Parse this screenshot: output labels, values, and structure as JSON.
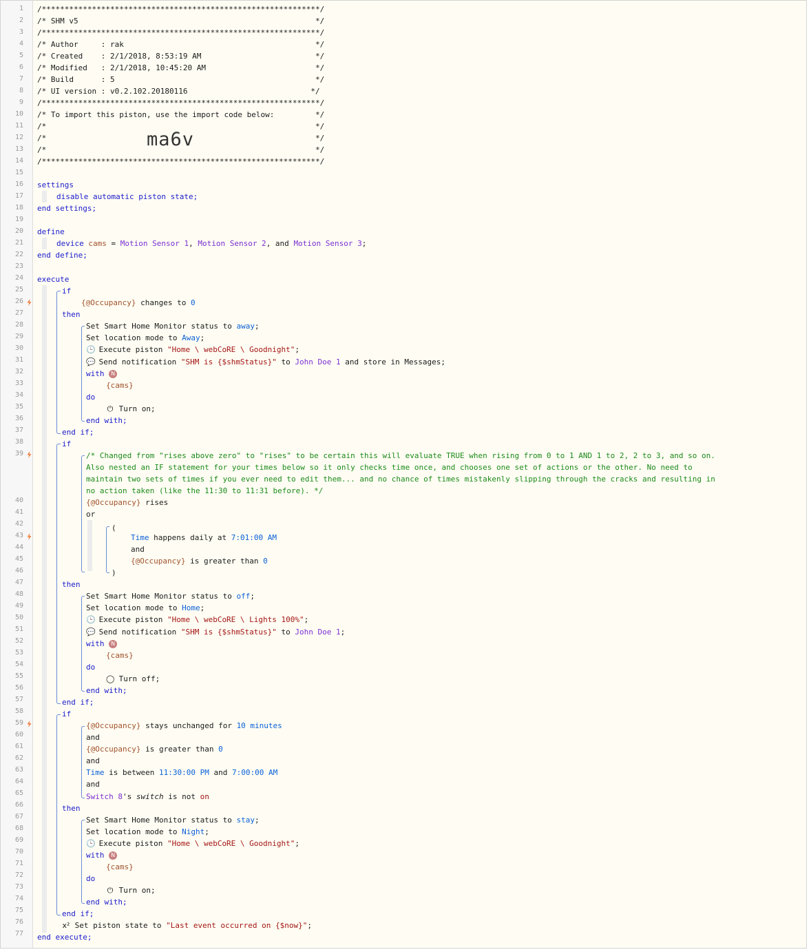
{
  "editor": {
    "line_numbers": [
      "1",
      "2",
      "3",
      "4",
      "5",
      "6",
      "7",
      "8",
      "9",
      "10",
      "11",
      "12",
      "13",
      "14",
      "15",
      "16",
      "17",
      "18",
      "19",
      "20",
      "21",
      "22",
      "23",
      "24",
      "25",
      "26",
      "27",
      "28",
      "29",
      "30",
      "31",
      "32",
      "33",
      "34",
      "35",
      "36",
      "37",
      "38",
      "39",
      "40",
      "41",
      "42",
      "43",
      "44",
      "45",
      "46",
      "47",
      "48",
      "49",
      "50",
      "51",
      "52",
      "53",
      "54",
      "55",
      "56",
      "57",
      "58",
      "59",
      "60",
      "61",
      "62",
      "63",
      "64",
      "65",
      "66",
      "67",
      "68",
      "69",
      "70",
      "71",
      "72",
      "73",
      "74",
      "75",
      "76",
      "77"
    ],
    "trigger_lines": [
      "26",
      "39",
      "43",
      "59"
    ],
    "header": {
      "border": "/*************************************************************/",
      "title": "/* SHM v5                                                    */",
      "author": "/* Author     : rak                                          */",
      "created": "/* Created    : 2/1/2018, 8:53:19 AM                         */",
      "modified": "/* Modified   : 2/1/2018, 10:45:20 AM                        */",
      "build": "/* Build      : 5                                            */",
      "ui_version": "/* UI version : v0.2.102.20180116                           */",
      "import_note": "/* To import this piston, use the import code below:         */",
      "blank_comment": "/*                                                           */",
      "import_code": "ma6v"
    },
    "settings": {
      "open": "settings",
      "body": "disable automatic piston state;",
      "close": "end settings;"
    },
    "define": {
      "open": "define",
      "device_kw": "device",
      "var_name": "cams",
      "eq": " = ",
      "dev1": "Motion Sensor 1",
      "sep1": ", ",
      "dev2": "Motion Sensor 2",
      "sep2": ", and ",
      "dev3": "Motion Sensor 3",
      "semi": ";",
      "close": "end define;"
    },
    "execute_open": "execute",
    "execute_close": "end execute;",
    "kw": {
      "if": "if",
      "then": "then",
      "end_if": "end if;",
      "with": "with",
      "do": "do",
      "end_with": "end with;",
      "and": "and",
      "or": "or",
      "open_paren": "(",
      "close_paren": ")",
      "n_badge": "N",
      "cams_ref": "{cams}",
      "occupancy": "{@Occupancy}"
    },
    "block1": {
      "cond_op": " changes to ",
      "cond_val": "0",
      "a1_pre": "Set Smart Home Monitor status to ",
      "a1_val": "away",
      "a2_pre": "Set location mode to ",
      "a2_val": "Away",
      "a3_pre": " Execute piston ",
      "a3_val": "\"Home \\ webCoRE \\ Goodnight\"",
      "a4_pre": " Send notification ",
      "a4_val": "\"SHM is {$shmStatus}\"",
      "a4_to": " to ",
      "a4_who": "John Doe 1",
      "a4_post": " and store in Messages;",
      "with_action": " Turn on;"
    },
    "block2": {
      "comment_1": "/* Changed from \"rises above zero\" to \"rises\" to be certain this will evaluate TRUE when rising from 0 to 1 AND 1 to 2, 2 to 3, and so on.",
      "comment_2": "Also nested an IF statement for your times below so it only checks time once, and chooses one set of actions or the other. No need to",
      "comment_3": "maintain two sets of times if you ever need to edit them... and no chance of times mistakenly slipping through the cracks and resulting in",
      "comment_4": "no action taken (like the 11:30 to 11:31 before). */",
      "cond1_op": " rises",
      "time_kw": "Time",
      "time_op": " happens daily at ",
      "time_val": "7:01:00 AM",
      "cond3_op": " is greater than ",
      "cond3_val": "0",
      "a1_pre": "Set Smart Home Monitor status to ",
      "a1_val": "off",
      "a2_pre": "Set location mode to ",
      "a2_val": "Home",
      "a3_pre": " Execute piston ",
      "a3_val": "\"Home \\ webCoRE \\ Lights 100%\"",
      "a4_pre": " Send notification ",
      "a4_val": "\"SHM is {$shmStatus}\"",
      "a4_to": " to ",
      "a4_who": "John Doe 1",
      "with_action": " Turn off;"
    },
    "block3": {
      "cond1_op": " stays unchanged for ",
      "cond1_val": "10 minutes",
      "cond2_op": " is greater than ",
      "cond2_val": "0",
      "time_kw": "Time",
      "time_op": " is between ",
      "time_v1": "11:30:00 PM",
      "time_and": " and ",
      "time_v2": "7:00:00 AM",
      "switch_dev": "Switch 8",
      "switch_poss": "'s ",
      "switch_attr": "switch",
      "switch_op": " is not ",
      "switch_val": "on",
      "a1_pre": "Set Smart Home Monitor status to ",
      "a1_val": "stay",
      "a2_pre": "Set location mode to ",
      "a2_val": "Night",
      "a3_pre": " Execute piston ",
      "a3_val": "\"Home \\ webCoRE \\ Goodnight\"",
      "with_action": " Turn on;"
    },
    "final": {
      "pre": " Set piston state to ",
      "val": "\"Last event occurred on {$now}\""
    }
  }
}
